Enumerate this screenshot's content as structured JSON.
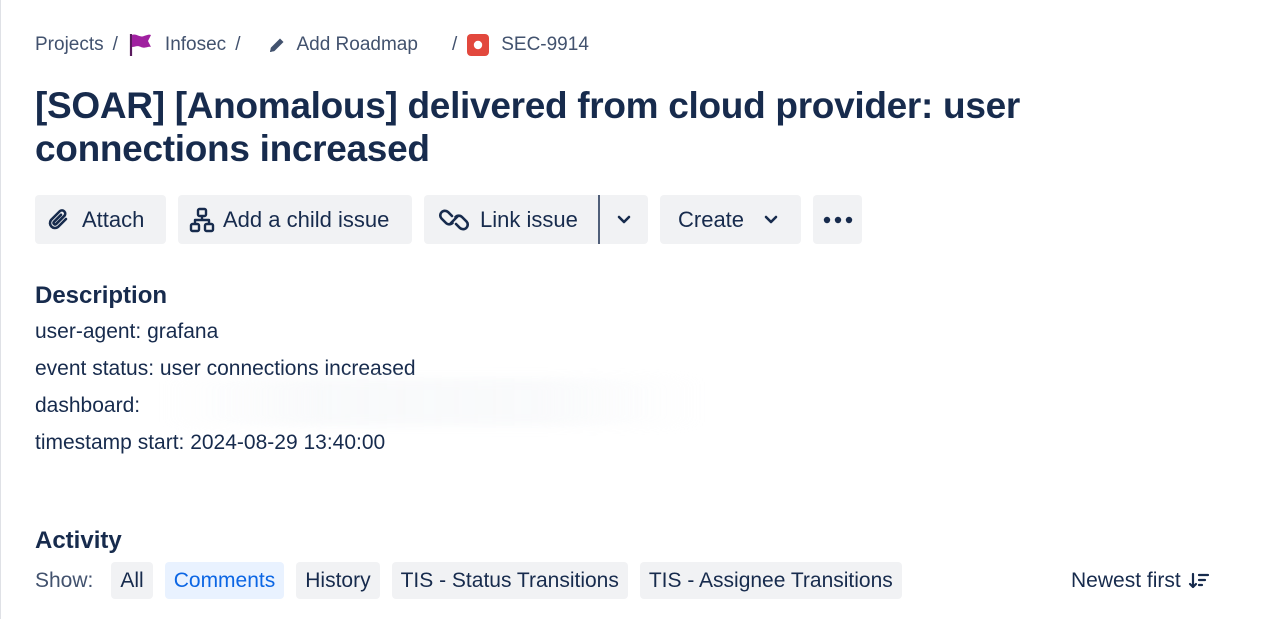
{
  "breadcrumb": {
    "items": [
      {
        "label": "Projects",
        "icon": "none"
      },
      {
        "label": "Infosec",
        "icon": "flag-icon"
      },
      {
        "label": "Add Roadmap",
        "icon": "pencil-icon"
      },
      {
        "label": "SEC-9914",
        "icon": "issue-type-icon"
      }
    ],
    "separator": "/"
  },
  "issue": {
    "title": "[SOAR] [Anomalous] delivered from cloud provider: user connections increased"
  },
  "toolbar": {
    "attach_label": "Attach",
    "add_child_label": "Add a child issue",
    "link_issue_label": "Link issue",
    "create_label": "Create"
  },
  "description": {
    "heading": "Description",
    "lines": [
      "user-agent: grafana",
      "event status: user connections increased",
      "dashboard:",
      "timestamp start: 2024-08-29 13:40:00"
    ]
  },
  "activity": {
    "heading": "Activity",
    "show_label": "Show:",
    "filters": [
      "All",
      "Comments",
      "History",
      "TIS - Status Transitions",
      "TIS - Assignee Transitions"
    ],
    "selected_filter": "Comments",
    "sort_label": "Newest first"
  },
  "colors": {
    "text": "#172b4d",
    "subtle_text": "#42526e",
    "button_bg": "#f1f2f4",
    "selected_bg": "#e9f2ff",
    "selected_text": "#0c66e4",
    "flag": "#a020a0",
    "issue_icon": "#e2483d"
  }
}
